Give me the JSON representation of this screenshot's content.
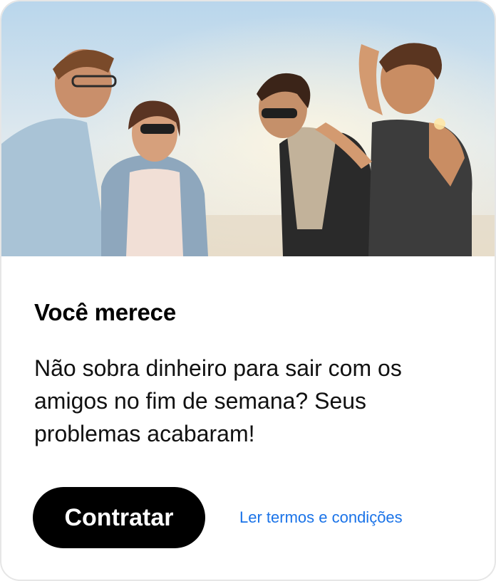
{
  "card": {
    "title": "Você merece",
    "description": "Não sobra dinheiro para sair com os amigos no fim de semana? Seus problemas acabaram!",
    "cta_label": "Contratar",
    "terms_link": "Ler termos e condições"
  },
  "colors": {
    "cta_background": "#000000",
    "link": "#1a73e8",
    "border": "#e6e6e6"
  }
}
